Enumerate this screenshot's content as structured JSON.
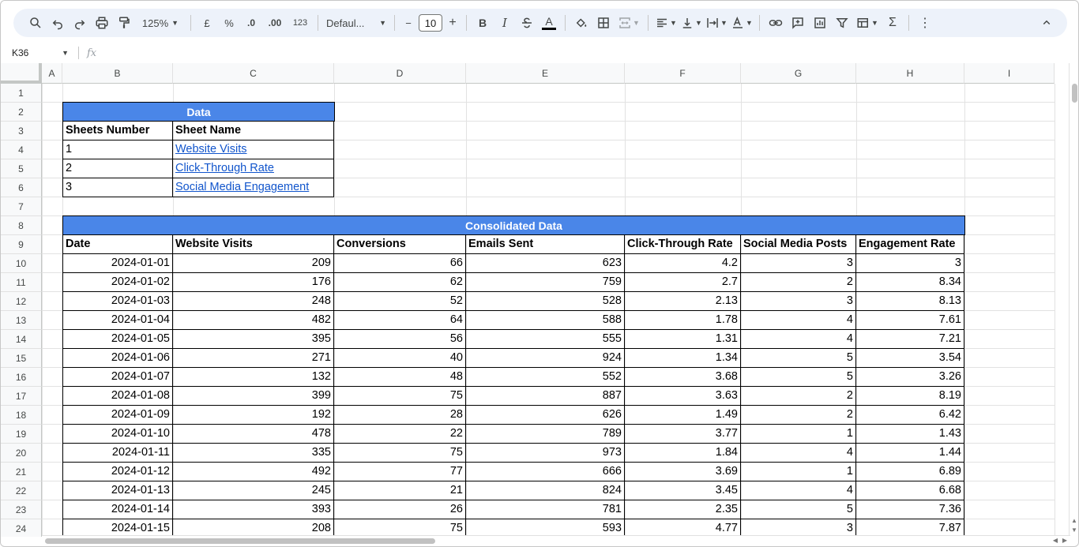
{
  "toolbar": {
    "zoom": "125%",
    "currency": "£",
    "percent": "%",
    "dec_decrease": ".0",
    "dec_increase": ".00",
    "number_format": "123",
    "font": "Defaul...",
    "font_size": "10",
    "minus": "−",
    "plus": "+",
    "bold": "B",
    "italic": "I",
    "text_color": "A",
    "sigma": "Σ",
    "more": "⋮",
    "collapse": "^"
  },
  "formula_bar": {
    "cell_ref": "K36",
    "fx": "fx",
    "value": ""
  },
  "columns": [
    "A",
    "B",
    "C",
    "D",
    "E",
    "F",
    "G",
    "H",
    "I"
  ],
  "rows": [
    "1",
    "2",
    "3",
    "4",
    "5",
    "6",
    "7",
    "8",
    "9",
    "10",
    "11",
    "12",
    "13",
    "14",
    "15",
    "16",
    "17",
    "18",
    "19",
    "20",
    "21",
    "22",
    "23",
    "24"
  ],
  "data_table": {
    "title": "Data",
    "headers": [
      "Sheets Number",
      "Sheet Name"
    ],
    "rows": [
      [
        "1",
        "Website Visits"
      ],
      [
        "2",
        "Click-Through Rate"
      ],
      [
        "3",
        "Social Media Engagement"
      ]
    ]
  },
  "consolidated": {
    "title": "Consolidated Data",
    "headers": [
      "Date",
      "Website Visits",
      "Conversions",
      "Emails Sent",
      "Click-Through Rate",
      "Social Media Posts",
      "Engagement Rate"
    ],
    "rows": [
      [
        "2024-01-01",
        "209",
        "66",
        "623",
        "4.2",
        "3",
        "3"
      ],
      [
        "2024-01-02",
        "176",
        "62",
        "759",
        "2.7",
        "2",
        "8.34"
      ],
      [
        "2024-01-03",
        "248",
        "52",
        "528",
        "2.13",
        "3",
        "8.13"
      ],
      [
        "2024-01-04",
        "482",
        "64",
        "588",
        "1.78",
        "4",
        "7.61"
      ],
      [
        "2024-01-05",
        "395",
        "56",
        "555",
        "1.31",
        "4",
        "7.21"
      ],
      [
        "2024-01-06",
        "271",
        "40",
        "924",
        "1.34",
        "5",
        "3.54"
      ],
      [
        "2024-01-07",
        "132",
        "48",
        "552",
        "3.68",
        "5",
        "3.26"
      ],
      [
        "2024-01-08",
        "399",
        "75",
        "887",
        "3.63",
        "2",
        "8.19"
      ],
      [
        "2024-01-09",
        "192",
        "28",
        "626",
        "1.49",
        "2",
        "6.42"
      ],
      [
        "2024-01-10",
        "478",
        "22",
        "789",
        "3.77",
        "1",
        "1.43"
      ],
      [
        "2024-01-11",
        "335",
        "75",
        "973",
        "1.84",
        "4",
        "1.44"
      ],
      [
        "2024-01-12",
        "492",
        "77",
        "666",
        "3.69",
        "1",
        "6.89"
      ],
      [
        "2024-01-13",
        "245",
        "21",
        "824",
        "3.45",
        "4",
        "6.68"
      ],
      [
        "2024-01-14",
        "393",
        "26",
        "781",
        "2.35",
        "5",
        "7.36"
      ],
      [
        "2024-01-15",
        "208",
        "75",
        "593",
        "4.77",
        "3",
        "7.87"
      ]
    ]
  },
  "colors": {
    "header_fill": "#4a86e8",
    "link": "#1155cc",
    "toolbar_bg": "#edf2fa"
  }
}
